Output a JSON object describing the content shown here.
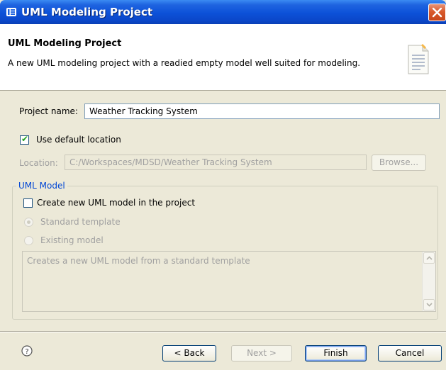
{
  "window": {
    "title": "UML Modeling Project"
  },
  "header": {
    "title": "UML Modeling Project",
    "description": "A new UML modeling project with a readied empty model well suited for modeling."
  },
  "project_name": {
    "label": "Project name:",
    "value": "Weather Tracking System"
  },
  "use_default_location": {
    "label": "Use default location",
    "checked": true
  },
  "location": {
    "label": "Location:",
    "value": "C:/Workspaces/MDSD/Weather Tracking System",
    "browse_label": "Browse..."
  },
  "uml_model": {
    "group_label": "UML Model",
    "create_checkbox_label": "Create new UML model in the project",
    "create_checked": false,
    "options": [
      "Standard template",
      "Existing model"
    ],
    "selected_option": "Standard template",
    "description": "Creates a new UML model from a standard template"
  },
  "buttons": {
    "back": "< Back",
    "next": "Next >",
    "finish": "Finish",
    "cancel": "Cancel"
  },
  "icons": {
    "title": "wizard-app-icon",
    "header": "document-icon",
    "help": "help-icon",
    "close": "close-icon"
  },
  "colors": {
    "titlebar": "#0a50d8",
    "group_title": "#0046d5",
    "check": "#21a121",
    "close_button": "#d95a2c"
  }
}
